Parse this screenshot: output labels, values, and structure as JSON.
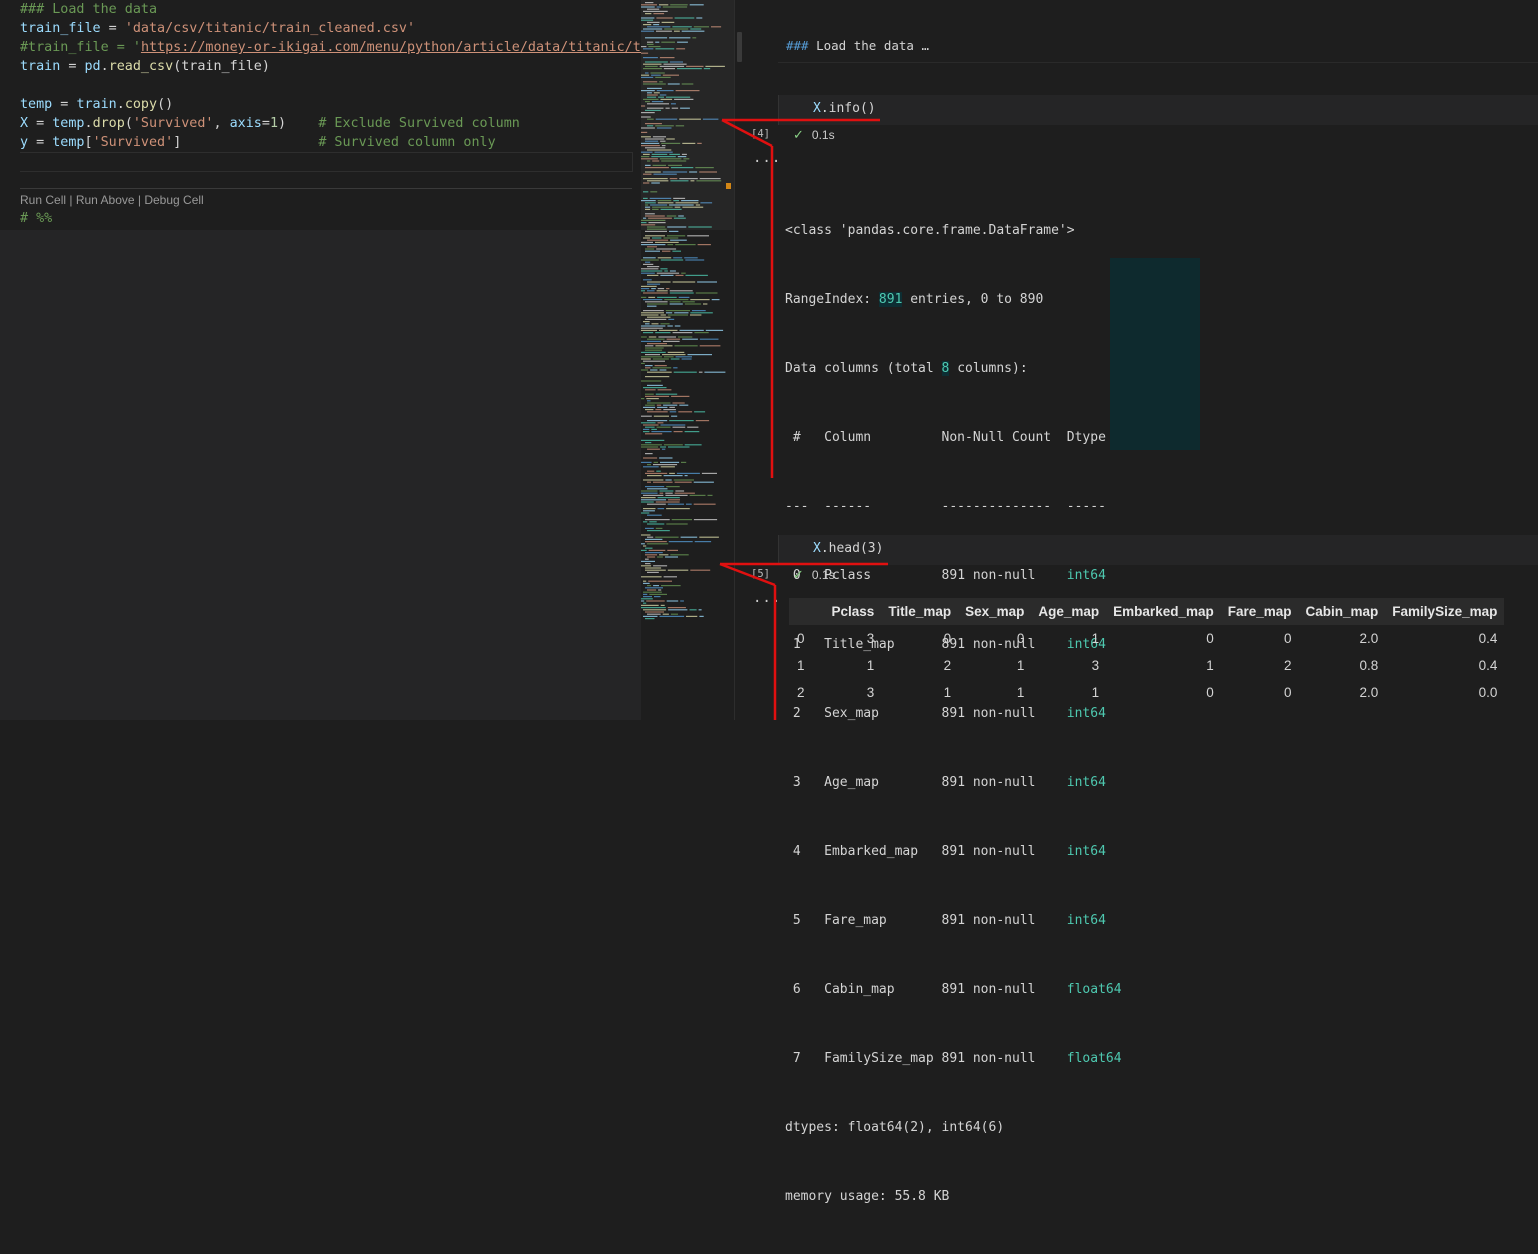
{
  "editor": {
    "lines": [
      {
        "kind": "comment",
        "text": "### Load the data"
      },
      {
        "kind": "assign",
        "var": "train_file",
        "op": " = ",
        "str": "'data/csv/titanic/train_cleaned.csv'"
      },
      {
        "kind": "comment_url",
        "prefix": "#train_file = '",
        "url": "https://money-or-ikigai.com/menu/python/article/data/titanic/trai"
      },
      {
        "kind": "call",
        "var": "train",
        "op": " = ",
        "obj": "pd",
        "dot": ".",
        "fn": "read_csv",
        "args": "(train_file)"
      },
      {
        "kind": "blank",
        "text": ""
      },
      {
        "kind": "call",
        "var": "temp",
        "op": " = ",
        "obj": "train",
        "dot": ".",
        "fn": "copy",
        "args": "()"
      },
      {
        "kind": "drop",
        "var": "X",
        "op": " = ",
        "obj": "temp",
        "fn": "drop",
        "str": "'Survived'",
        "kw": "axis",
        "num": "1",
        "comment": "# Exclude Survived column"
      },
      {
        "kind": "index",
        "var": "y",
        "op": " = ",
        "obj": "temp",
        "str": "'Survived'",
        "comment": "# Survived column only"
      }
    ],
    "codelens": [
      "Run Cell",
      "Run Above",
      "Debug Cell"
    ],
    "cell_marker": "# %%"
  },
  "interactive": {
    "md_cell": {
      "hash": "###",
      "text": "Load the data",
      "ellipsis": "…"
    },
    "cell1": {
      "code_var": "X",
      "code_rest": ".info()",
      "exec_count": "[4]",
      "status": "0.1s",
      "output": {
        "line1": "<class 'pandas.core.frame.DataFrame'>",
        "range_prefix": "RangeIndex: ",
        "range_num": "891",
        "range_suffix": " entries, 0 to 890",
        "cols_prefix": "Data columns (total ",
        "cols_num": "8",
        "cols_suffix": " columns):",
        "header": " #   Column         Non-Null Count  Dtype",
        "dashes": "---  ------         --------------  -----",
        "rows": [
          {
            "idx": " 0",
            "col": "Pclass       ",
            "nn": "891 non-null",
            "dtype": "int64"
          },
          {
            "idx": " 1",
            "col": "Title_map    ",
            "nn": "891 non-null",
            "dtype": "int64"
          },
          {
            "idx": " 2",
            "col": "Sex_map      ",
            "nn": "891 non-null",
            "dtype": "int64"
          },
          {
            "idx": " 3",
            "col": "Age_map      ",
            "nn": "891 non-null",
            "dtype": "int64"
          },
          {
            "idx": " 4",
            "col": "Embarked_map ",
            "nn": "891 non-null",
            "dtype": "int64"
          },
          {
            "idx": " 5",
            "col": "Fare_map     ",
            "nn": "891 non-null",
            "dtype": "int64"
          },
          {
            "idx": " 6",
            "col": "Cabin_map    ",
            "nn": "891 non-null",
            "dtype": "float64"
          },
          {
            "idx": " 7",
            "col": "FamilySize_map",
            "nn": "891 non-null",
            "dtype": "float64"
          }
        ],
        "dtypes": "dtypes: float64(2), int64(6)",
        "memory": "memory usage: 55.8 KB"
      }
    },
    "cell2": {
      "code_var": "X",
      "code_rest": ".head(3)",
      "exec_count": "[5]",
      "status": "0.1s",
      "table": {
        "columns": [
          "",
          "Pclass",
          "Title_map",
          "Sex_map",
          "Age_map",
          "Embarked_map",
          "Fare_map",
          "Cabin_map",
          "FamilySize_map"
        ],
        "rows": [
          [
            "0",
            "3",
            "0",
            "0",
            "1",
            "0",
            "0",
            "2.0",
            "0.4"
          ],
          [
            "1",
            "1",
            "2",
            "1",
            "3",
            "1",
            "2",
            "0.8",
            "0.4"
          ],
          [
            "2",
            "3",
            "1",
            "1",
            "1",
            "0",
            "0",
            "2.0",
            "0.0"
          ]
        ]
      }
    },
    "more_label": "..."
  },
  "colors": {
    "annotation_red": "#e01010",
    "accent_teal": "#4ec9b0",
    "check_green": "#89d185"
  }
}
